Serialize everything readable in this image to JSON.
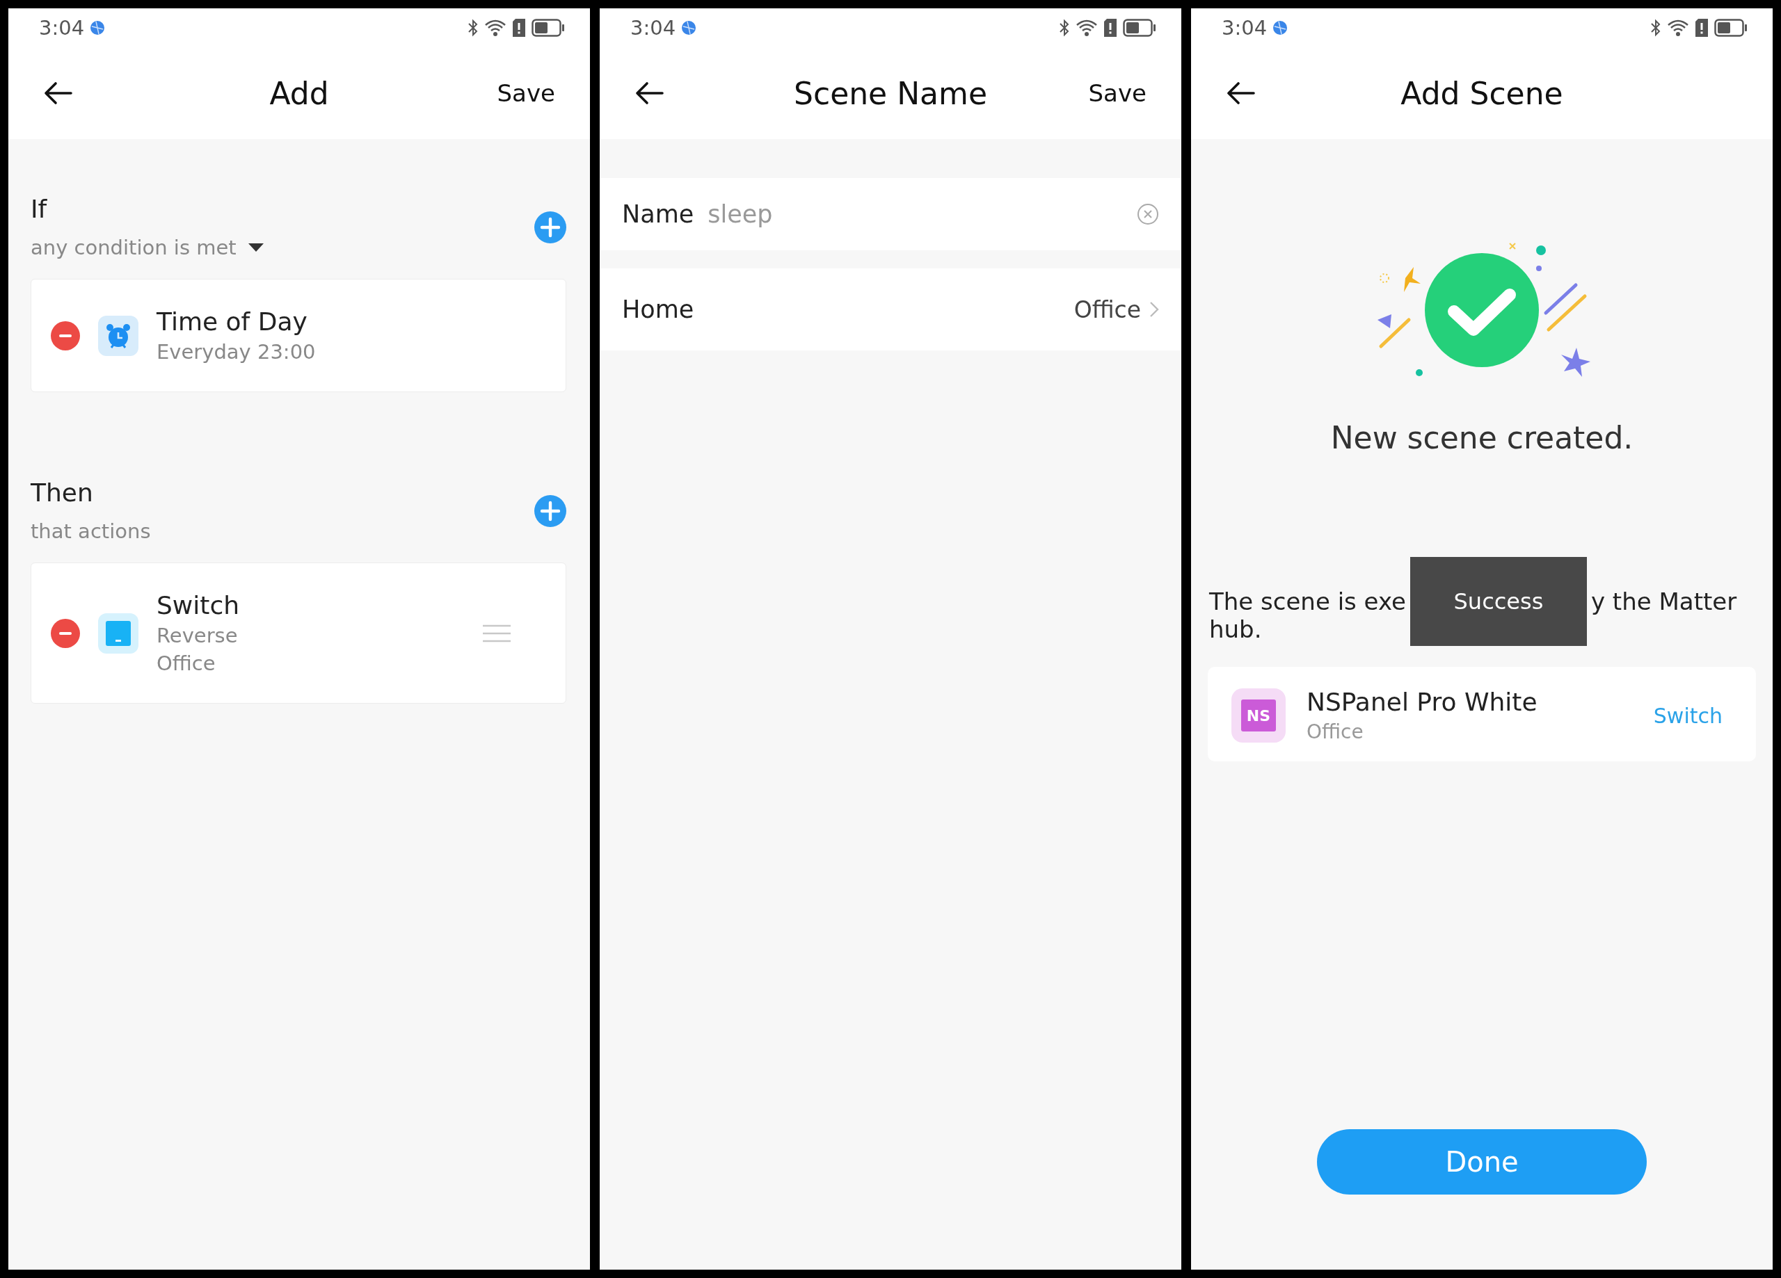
{
  "screens": [
    {
      "kind": "rule_editor",
      "status_time": "3:04",
      "title": "Add",
      "action": "Save",
      "sections": [
        {
          "title": "If",
          "subtitle": "any condition is met",
          "dropdown": true,
          "items": [
            {
              "title": "Time of Day",
              "lines": [
                "Everyday 23:00"
              ],
              "draggable": false
            }
          ]
        },
        {
          "title": "Then",
          "subtitle": "that actions",
          "dropdown": false,
          "items": [
            {
              "title": "Switch",
              "lines": [
                "Reverse",
                "Office"
              ],
              "draggable": true
            }
          ]
        }
      ]
    },
    {
      "kind": "name_form",
      "status_time": "3:04",
      "title": "Scene Name",
      "action": "Save",
      "name_field": {
        "label": "Name",
        "value": "sleep"
      },
      "home_row": {
        "label": "Home",
        "value": "Office"
      }
    },
    {
      "kind": "success",
      "status_time": "3:04",
      "title": "Add Scene",
      "message": "New scene created.",
      "note_parts": [
        "The scene is exe",
        "y the Matter",
        "hub."
      ],
      "toast": "Success",
      "device": {
        "badge": "NS",
        "name": "NSPanel Pro White",
        "room": "Office",
        "link": "Switch"
      },
      "button": "Done"
    }
  ]
}
